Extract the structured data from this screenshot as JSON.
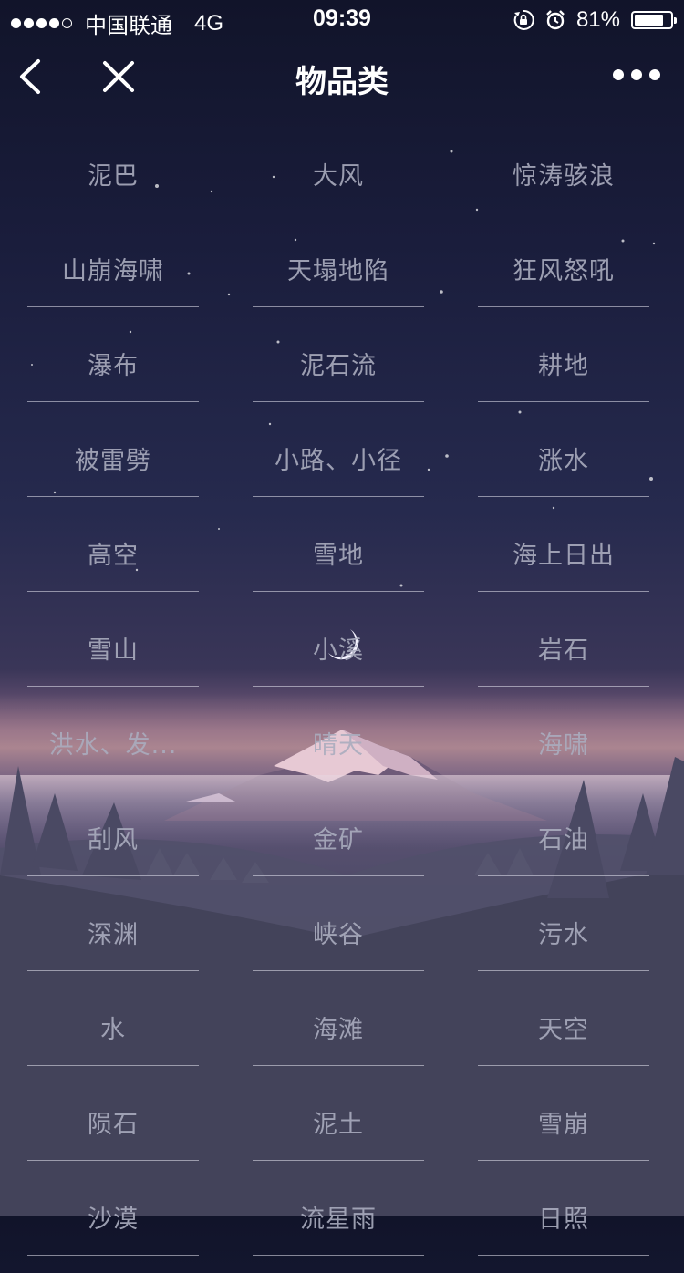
{
  "status_bar": {
    "carrier": "中国联通",
    "network": "4G",
    "time": "09:39",
    "battery_percent": "81%",
    "battery_level": 0.81,
    "icons": [
      "signal-dots-icon",
      "rotation-lock-icon",
      "alarm-icon",
      "battery-icon"
    ]
  },
  "nav": {
    "title": "物品类",
    "icons": [
      "back-chevron-icon",
      "close-icon",
      "more-icon"
    ]
  },
  "items": [
    "泥巴",
    "大风",
    "惊涛骇浪",
    "山崩海啸",
    "天塌地陷",
    "狂风怒吼",
    "瀑布",
    "泥石流",
    "耕地",
    "被雷劈",
    "小路、小径",
    "涨水",
    "高空",
    "雪地",
    "海上日出",
    "雪山",
    "小溪",
    "岩石",
    "洪水、发...",
    "晴天",
    "海啸",
    "刮风",
    "金矿",
    "石油",
    "深渊",
    "峡谷",
    "污水",
    "水",
    "海滩",
    "天空",
    "陨石",
    "泥土",
    "雪崩",
    "沙漠",
    "流星雨",
    "日照"
  ],
  "colors": {
    "text": "#aaacbe",
    "divider": "#e6e6f0",
    "sky_top": "#11142a",
    "horizon": "#7a5d7e"
  }
}
